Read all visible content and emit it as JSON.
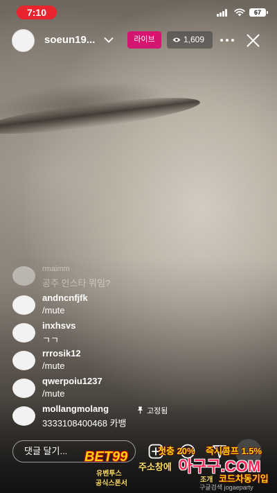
{
  "status_bar": {
    "time": "7:10",
    "battery": "67"
  },
  "header": {
    "username": "soeun19...",
    "live_label": "라이브",
    "viewer_count": "1,609"
  },
  "comments": [
    {
      "username": "rmaimm",
      "text": "공주 인스타 뭐임?",
      "faded": true
    },
    {
      "username": "andncnfjfk",
      "text": "/mute"
    },
    {
      "username": "inxhsvs",
      "text": "ㄱㄱ"
    },
    {
      "username": "rrrosik12",
      "text": "/mute"
    },
    {
      "username": "qwerpoiu1237",
      "text": "/mute"
    },
    {
      "username": "mollangmolang",
      "text": "3333108400468 카뱅",
      "pinned_label": "고정됨"
    }
  ],
  "comment_input": {
    "placeholder": "댓글 달기..."
  },
  "ad": {
    "logo": "BET99",
    "sub1": "유벤투스",
    "sub2": "공식스폰서",
    "promo1": "첫충 20%",
    "promo2": "즉시콤프 1.5%",
    "address_label": "주소창에",
    "domain": "아구구.COM",
    "code_label": "조개",
    "code": "코드차동기입",
    "small": "구글검색 jogaeparty"
  }
}
